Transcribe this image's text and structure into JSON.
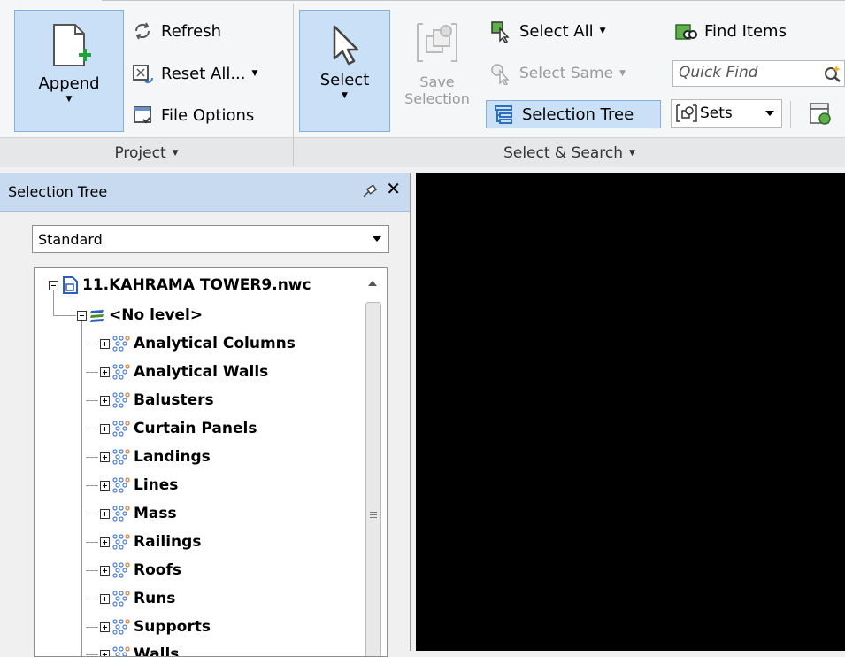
{
  "ribbon": {
    "project": {
      "append_label": "Append",
      "refresh_label": "Refresh",
      "reset_all_label": "Reset All...",
      "file_options_label": "File Options",
      "footer": "Project"
    },
    "select_search": {
      "select_label": "Select",
      "save_selection_line1": "Save",
      "save_selection_line2": "Selection",
      "select_all_label": "Select All",
      "select_same_label": "Select Same",
      "selection_tree_label": "Selection Tree",
      "find_items_label": "Find Items",
      "quick_find_placeholder": "Quick Find",
      "sets_label": "Sets",
      "footer": "Select & Search"
    }
  },
  "selection_tree": {
    "title": "Selection Tree",
    "mode": "Standard",
    "root": "11.KAHRAMA TOWER9.nwc",
    "level": "<No level>",
    "items": [
      "Analytical Columns",
      "Analytical Walls",
      "Balusters",
      "Curtain Panels",
      "Landings",
      "Lines",
      "Mass",
      "Railings",
      "Roofs",
      "Runs",
      "Supports",
      "Walls"
    ]
  },
  "colors": {
    "active_button": "#c9e0f7",
    "panel_title": "#c8daf0",
    "viewport": "#000000"
  }
}
